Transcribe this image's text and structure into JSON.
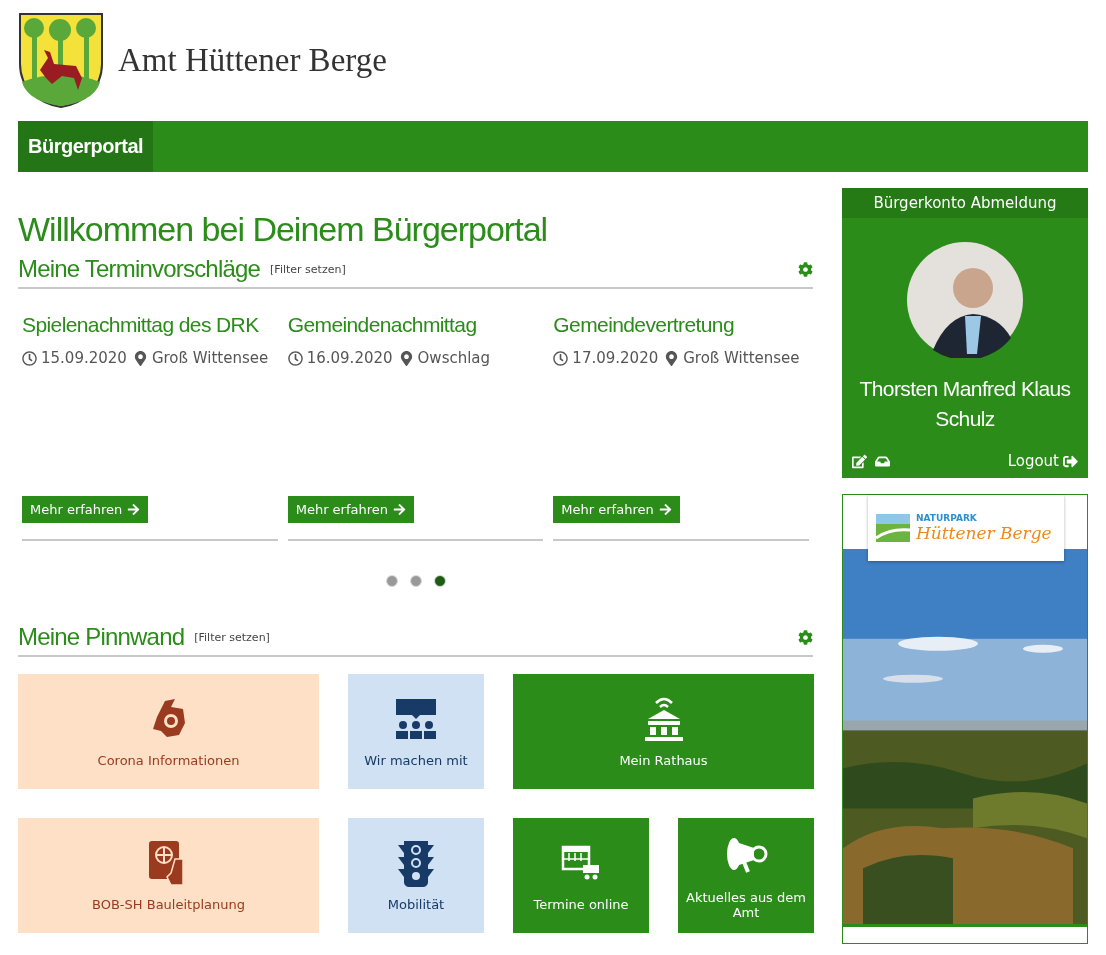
{
  "site_title": "Amt Hüttener Berge",
  "nav": [
    {
      "label": "Bürgerportal",
      "selected": true
    }
  ],
  "welcome": "Willkommen bei Deinem Bürgerportal",
  "appointments": {
    "heading": "Meine Terminvorschläge",
    "filter": "[Filter setzen]",
    "events": [
      {
        "title": "Spielenachmittag des DRK",
        "date": "15.09.2020",
        "place": "Groß Wittensee",
        "button": "Mehr erfahren"
      },
      {
        "title": "Gemeindenachmittag",
        "date": "16.09.2020",
        "place": "Owschlag",
        "button": "Mehr erfahren"
      },
      {
        "title": "Gemeindevertretung",
        "date": "17.09.2020",
        "place": "Groß Wittensee",
        "button": "Mehr erfahren"
      }
    ],
    "pages": [
      {
        "selected": false
      },
      {
        "selected": false
      },
      {
        "selected": true
      }
    ]
  },
  "pinboard": {
    "heading": "Meine Pinnwand",
    "filter": "[Filter setzen]",
    "tiles": [
      {
        "label": "Corona Informationen",
        "kind": "peach"
      },
      {
        "label": "Wir machen mit",
        "kind": "blue"
      },
      {
        "label": "Mein Rathaus",
        "kind": "green"
      },
      {
        "label": "BOB-SH Bauleitplanung",
        "kind": "peach"
      },
      {
        "label": "Mobilität",
        "kind": "blue"
      },
      {
        "label": "Termine online",
        "kind": "green"
      },
      {
        "label": "Aktuelles aus dem Amt",
        "kind": "green"
      }
    ]
  },
  "account": {
    "header": "Bürgerkonto Abmeldung",
    "name": "Thorsten Manfred Klaus Schulz",
    "logout": "Logout"
  },
  "ad": {
    "kicker": "NATURPARK",
    "title": "Hüttener Berge"
  }
}
